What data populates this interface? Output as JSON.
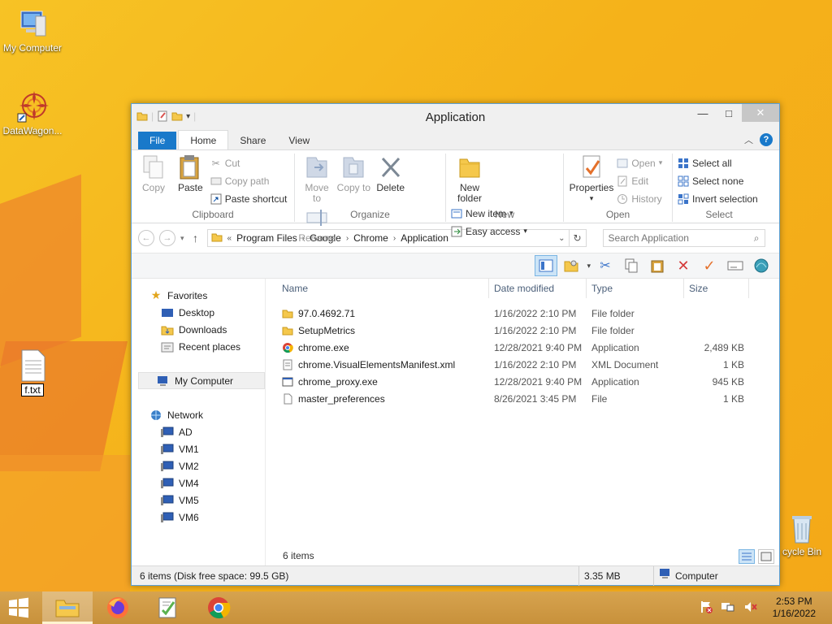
{
  "desktop": {
    "icons": [
      {
        "label": "My Computer"
      },
      {
        "label": "DataWagon..."
      },
      {
        "label": "f.txt"
      },
      {
        "label": "cycle Bin"
      }
    ]
  },
  "window": {
    "title": "Application",
    "controls": {
      "minimize": "—",
      "maximize": "□",
      "close": "✕"
    }
  },
  "ribbon": {
    "tabs": [
      "File",
      "Home",
      "Share",
      "View"
    ],
    "help": "?",
    "groups": {
      "clipboard": {
        "label": "Clipboard",
        "copy": "Copy",
        "paste": "Paste",
        "cut": "Cut",
        "copy_path": "Copy path",
        "paste_shortcut": "Paste shortcut"
      },
      "organize": {
        "label": "Organize",
        "move_to": "Move to",
        "copy_to": "Copy to",
        "delete": "Delete",
        "rename": "Rename"
      },
      "new": {
        "label": "New",
        "new_folder": "New folder",
        "new_item": "New item",
        "easy_access": "Easy access"
      },
      "open": {
        "label": "Open",
        "properties": "Properties",
        "open": "Open",
        "edit": "Edit",
        "history": "History"
      },
      "select": {
        "label": "Select",
        "select_all": "Select all",
        "select_none": "Select none",
        "invert_selection": "Invert selection"
      }
    }
  },
  "address": {
    "prefix": "«",
    "crumbs": [
      "Program Files",
      "Google",
      "Chrome",
      "Application"
    ],
    "search_placeholder": "Search Application"
  },
  "navpane": {
    "favorites": "Favorites",
    "favorite_items": [
      "Desktop",
      "Downloads",
      "Recent places"
    ],
    "computer": "My Computer",
    "network": "Network",
    "network_items": [
      "AD",
      "VM1",
      "VM2",
      "VM4",
      "VM5",
      "VM6"
    ]
  },
  "files": {
    "columns": {
      "name": "Name",
      "date": "Date modified",
      "type": "Type",
      "size": "Size"
    },
    "rows": [
      {
        "name": "97.0.4692.71",
        "date": "1/16/2022 2:10 PM",
        "type": "File folder",
        "size": "",
        "icon": "folder-icon"
      },
      {
        "name": "SetupMetrics",
        "date": "1/16/2022 2:10 PM",
        "type": "File folder",
        "size": "",
        "icon": "folder-icon"
      },
      {
        "name": "chrome.exe",
        "date": "12/28/2021 9:40 PM",
        "type": "Application",
        "size": "2,489 KB",
        "icon": "chrome-icon"
      },
      {
        "name": "chrome.VisualElementsManifest.xml",
        "date": "1/16/2022 2:10 PM",
        "type": "XML Document",
        "size": "1 KB",
        "icon": "xml-icon"
      },
      {
        "name": "chrome_proxy.exe",
        "date": "12/28/2021 9:40 PM",
        "type": "Application",
        "size": "945 KB",
        "icon": "exe-icon"
      },
      {
        "name": "master_preferences",
        "date": "8/26/2021 3:45 PM",
        "type": "File",
        "size": "1 KB",
        "icon": "file-icon"
      }
    ],
    "count": "6 items"
  },
  "status": {
    "left": "6 items (Disk free space: 99.5 GB)",
    "size": "3.35 MB",
    "location": "Computer"
  },
  "taskbar": {
    "time": "2:53 PM",
    "date": "1/16/2022"
  },
  "colors": {
    "accent": "#1979ca",
    "desktop": "#f5b21a",
    "taskbar": "#c8913b"
  }
}
